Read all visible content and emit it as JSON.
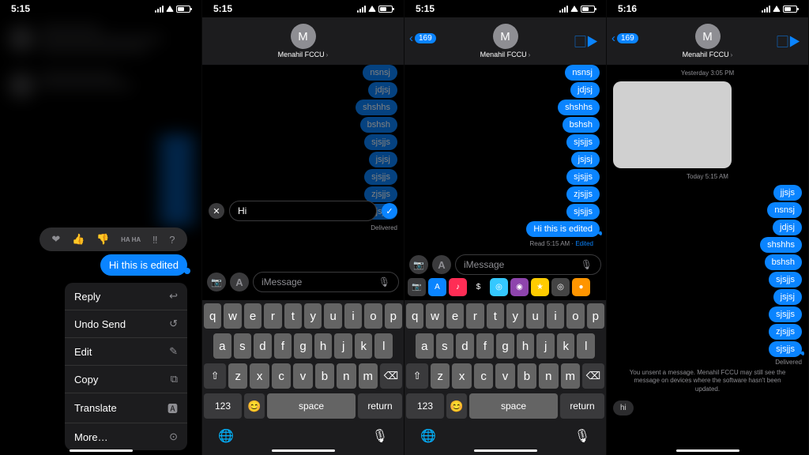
{
  "status": {
    "time_a": "5:15",
    "time_b": "5:16"
  },
  "contact": {
    "name": "Menahil FCCU",
    "initial": "M",
    "back_count": "169"
  },
  "reactions": [
    "❤︎",
    "👍",
    "👎",
    "HA HA",
    "‼︎",
    "?"
  ],
  "selected_bubble": "Hi this is edited",
  "context_menu": [
    {
      "label": "Reply",
      "icon": "↩︎"
    },
    {
      "label": "Undo Send",
      "icon": "↺"
    },
    {
      "label": "Edit",
      "icon": "✎"
    },
    {
      "label": "Copy",
      "icon": "⧉"
    },
    {
      "label": "Translate",
      "icon": "🅰"
    },
    {
      "label": "More…",
      "icon": "⊙"
    }
  ],
  "edit": {
    "value": "Hi",
    "delivered": "Delivered"
  },
  "msgs_p2": [
    "nsnsj",
    "jdjsj",
    "shshhs",
    "bshsh",
    "sjsjjs",
    "jsjsj",
    "sjsjjs",
    "zjsjjs",
    "sjsjjs"
  ],
  "msgs_p3": [
    "nsnsj",
    "jdjsj",
    "shshhs",
    "bshsh",
    "sjsjjs",
    "jsjsj",
    "sjsjjs",
    "zjsjjs",
    "sjsjjs",
    "Hi this is edited"
  ],
  "p3_status": {
    "read": "Read 5:15 AM",
    "edited": "Edited"
  },
  "input": {
    "placeholder": "iMessage",
    "mic": "🎤"
  },
  "apps": [
    {
      "bg": "#3a3a3c",
      "txt": "📷"
    },
    {
      "bg": "#0a84ff",
      "txt": "A"
    },
    {
      "bg": "#ff2d55",
      "txt": "♪"
    },
    {
      "bg": "#000",
      "txt": "$"
    },
    {
      "bg": "#34c8ff",
      "txt": "◎"
    },
    {
      "bg": "#8e44ad",
      "txt": "◉"
    },
    {
      "bg": "#ffcc00",
      "txt": "★"
    },
    {
      "bg": "#444",
      "txt": "◎"
    },
    {
      "bg": "#ff9500",
      "txt": "●"
    }
  ],
  "kbd": {
    "r1": [
      "q",
      "w",
      "e",
      "r",
      "t",
      "y",
      "u",
      "i",
      "o",
      "p"
    ],
    "r2": [
      "a",
      "s",
      "d",
      "f",
      "g",
      "h",
      "j",
      "k",
      "l"
    ],
    "r3": [
      "z",
      "x",
      "c",
      "v",
      "b",
      "n",
      "m"
    ],
    "shift": "⇧",
    "del": "⌫",
    "num": "123",
    "emoji": "😊",
    "space": "space",
    "ret": "return",
    "globe": "🌐",
    "mic": "🎙"
  },
  "p4": {
    "ts1": "Yesterday 3:05 PM",
    "ts2": "Today 5:15 AM",
    "msgs": [
      "jjsjs",
      "nsnsj",
      "jdjsj",
      "shshhs",
      "bshsh",
      "sjsjjs",
      "jsjsj",
      "sjsjjs",
      "zjsjjs",
      "sjsjjs"
    ],
    "delivered": "Delivered",
    "unsent_note": "You unsent a message. Menahil FCCU may still see the message on devices where the software hasn't been updated.",
    "unsent_bubble": "hi"
  }
}
